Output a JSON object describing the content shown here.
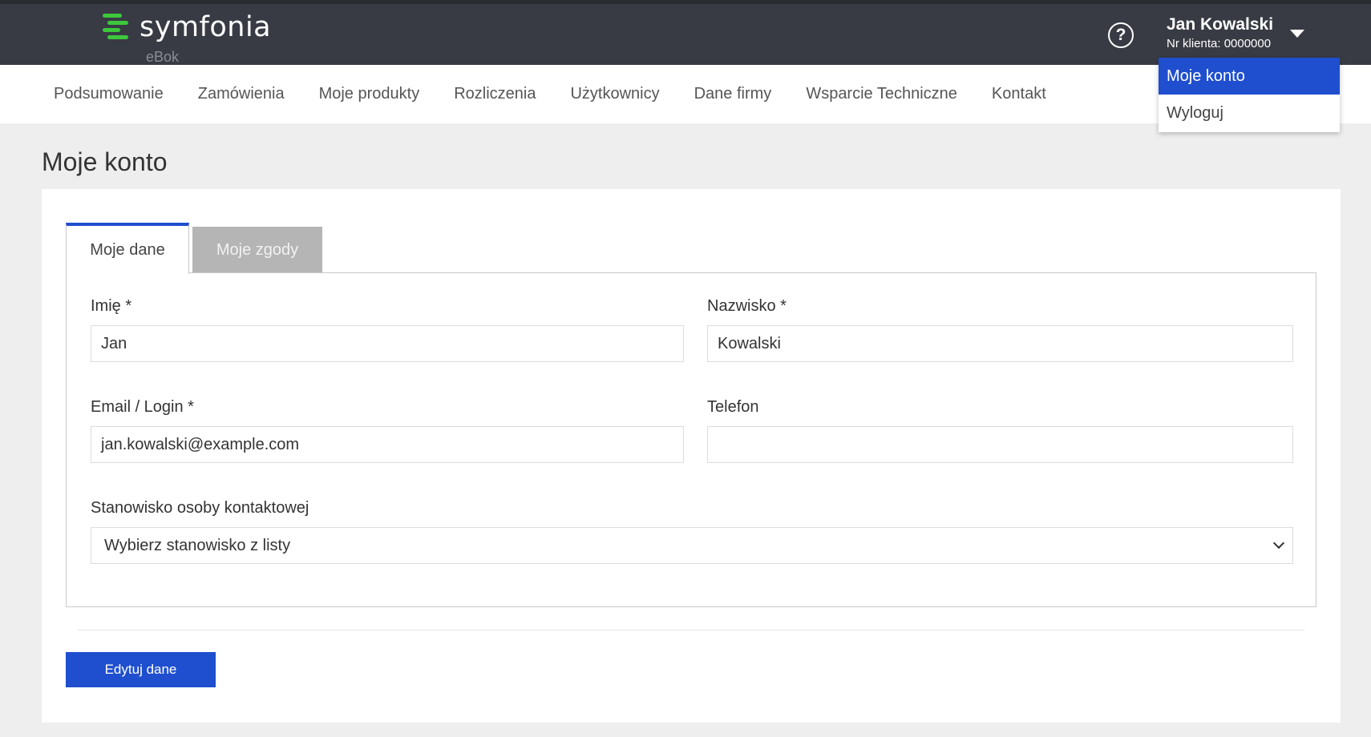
{
  "header": {
    "logo_text": "symfonia",
    "logo_sub": "eBok",
    "help_glyph": "?",
    "user_name": "Jan Kowalski",
    "client_id": "Nr klienta: 0000000"
  },
  "user_menu": {
    "items": [
      {
        "label": "Moje konto",
        "active": true
      },
      {
        "label": "Wyloguj",
        "active": false
      }
    ]
  },
  "nav": {
    "items": [
      {
        "label": "Podsumowanie"
      },
      {
        "label": "Zamówienia"
      },
      {
        "label": "Moje produkty"
      },
      {
        "label": "Rozliczenia"
      },
      {
        "label": "Użytkownicy"
      },
      {
        "label": "Dane firmy"
      },
      {
        "label": "Wsparcie Techniczne"
      },
      {
        "label": "Kontakt"
      }
    ]
  },
  "page": {
    "title": "Moje konto"
  },
  "tabs": [
    {
      "label": "Moje dane",
      "active": true
    },
    {
      "label": "Moje zgody",
      "active": false
    }
  ],
  "form": {
    "first_name": {
      "label": "Imię *",
      "value": "Jan"
    },
    "last_name": {
      "label": "Nazwisko *",
      "value": "Kowalski"
    },
    "email": {
      "label": "Email / Login *",
      "value": "jan.kowalski@example.com"
    },
    "phone": {
      "label": "Telefon",
      "value": ""
    },
    "position": {
      "label": "Stanowisko osoby kontaktowej",
      "value": "Wybierz stanowisko z listy"
    }
  },
  "actions": {
    "edit_label": "Edytuj dane"
  },
  "colors": {
    "header_bg": "#383b44",
    "accent": "#1f4fcf",
    "logo_green": "#3cc83c",
    "tab_inactive": "#b5b5b5"
  },
  "icons": {
    "logo": "symfonia-logo-icon",
    "help": "help-circle-icon",
    "user_menu": "caret-down-icon",
    "select": "chevron-down-icon"
  }
}
